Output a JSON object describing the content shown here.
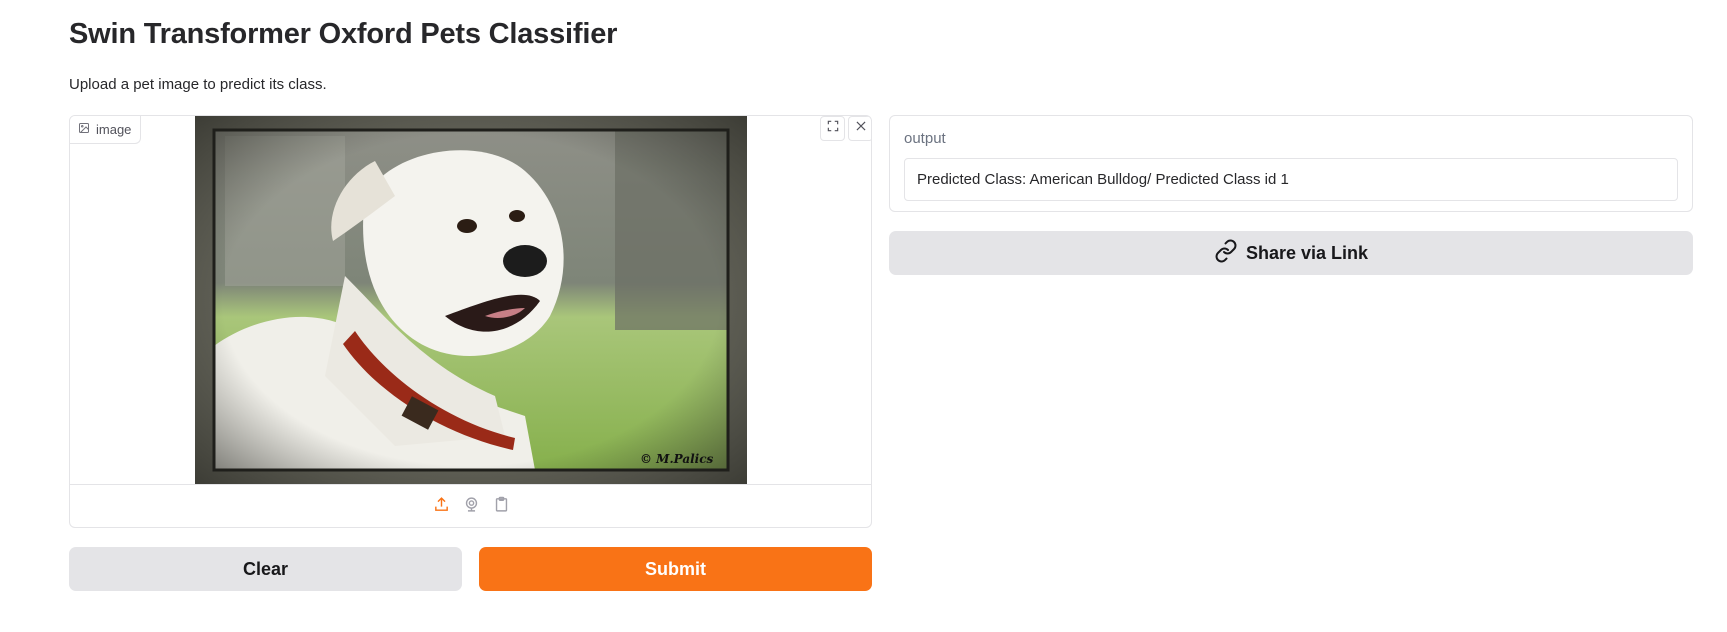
{
  "header": {
    "title": "Swin Transformer Oxford Pets Classifier",
    "description": "Upload a pet image to predict its class."
  },
  "image_input": {
    "label": "image",
    "label_icon": "image-icon",
    "corner_icons": [
      "fullscreen-icon",
      "close-icon"
    ],
    "source_icons": [
      "upload-icon",
      "webcam-icon",
      "clipboard-icon"
    ],
    "watermark": "© M.Palics"
  },
  "actions": {
    "clear_label": "Clear",
    "submit_label": "Submit"
  },
  "output": {
    "label": "output",
    "value": "Predicted Class: American Bulldog/ Predicted Class id 1"
  },
  "share": {
    "label": "Share via Link",
    "icon": "link-icon"
  },
  "colors": {
    "accent": "#f97316",
    "secondary_button": "#e4e4e7",
    "border": "#e4e4e7"
  }
}
